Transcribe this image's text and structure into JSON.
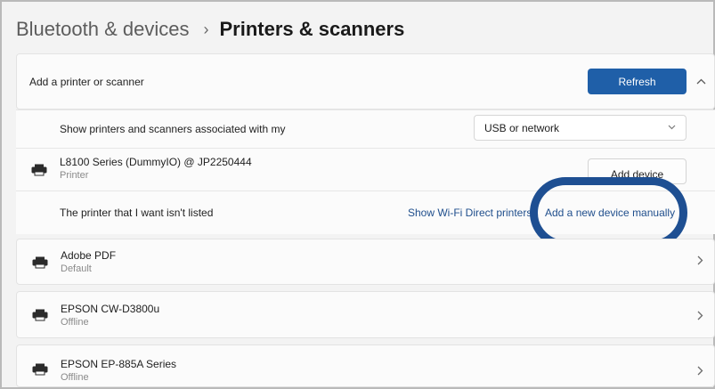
{
  "breadcrumb": {
    "parent": "Bluetooth & devices",
    "separator": "›",
    "current": "Printers & scanners"
  },
  "add_section": {
    "label": "Add a printer or scanner",
    "refresh_label": "Refresh",
    "collapse_icon": "chevron-up-icon"
  },
  "show_assoc": {
    "label": "Show printers and scanners associated with my",
    "selected": "USB or network",
    "dropdown_icon": "chevron-down-icon"
  },
  "found_device": {
    "name": "L8100 Series (DummyIO) @ JP2250444",
    "type": "Printer",
    "add_label": "Add device"
  },
  "not_listed": {
    "label": "The printer that I want isn't listed",
    "wifi_direct_link": "Show Wi-Fi Direct printers",
    "manual_link": "Add a new device manually"
  },
  "printers": [
    {
      "name": "Adobe PDF",
      "status": "Default"
    },
    {
      "name": "EPSON CW-D3800u",
      "status": "Offline"
    },
    {
      "name": "EPSON EP-885A Series",
      "status": "Offline"
    }
  ],
  "colors": {
    "accent": "#1f5fa8",
    "link": "#1f4e8c",
    "highlight_ring": "#1e4f92"
  }
}
